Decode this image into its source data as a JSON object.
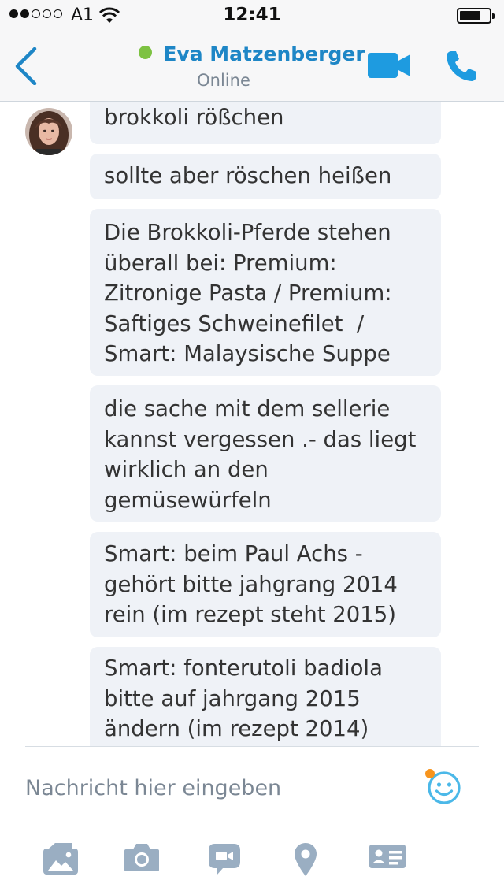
{
  "status_bar": {
    "carrier": "A1",
    "time": "12:41",
    "signal_bars_filled": 2,
    "signal_bars_total": 5,
    "battery_level": 0.65
  },
  "header": {
    "contact_name": "Eva Matzenberger",
    "presence": "Online",
    "presence_color": "#7dc242",
    "accent_color": "#1e86c6",
    "icons": [
      "back-chevron-icon",
      "video-call-icon",
      "phone-icon"
    ]
  },
  "messages": [
    {
      "text": "brokkoli rößchen"
    },
    {
      "text": "sollte aber röschen heißen"
    },
    {
      "text": "Die Brokkoli-Pferde stehen\nüberall bei: Premium:\nZitronige Pasta / Premium:\nSaftiges Schweinefilet  /\nSmart: Malaysische Suppe"
    },
    {
      "text": "die sache mit dem sellerie\nkannst vergessen .- das liegt\nwirklich an den\ngemüsewürfeln"
    },
    {
      "text": "Smart: beim Paul Achs -\ngehört bitte jahgrang 2014\nrein (im rezept steht 2015)"
    },
    {
      "text": "Smart: fonterutoli badiola\nbitte auf jahrgang 2015\nändern (im rezept 2014)"
    }
  ],
  "composer": {
    "placeholder": "Nachricht hier eingeben",
    "emoji_icon": "emoticon-icon"
  },
  "toolbar": {
    "icons": [
      "media-icon",
      "camera-icon",
      "video-message-icon",
      "location-icon",
      "contact-card-icon"
    ]
  }
}
